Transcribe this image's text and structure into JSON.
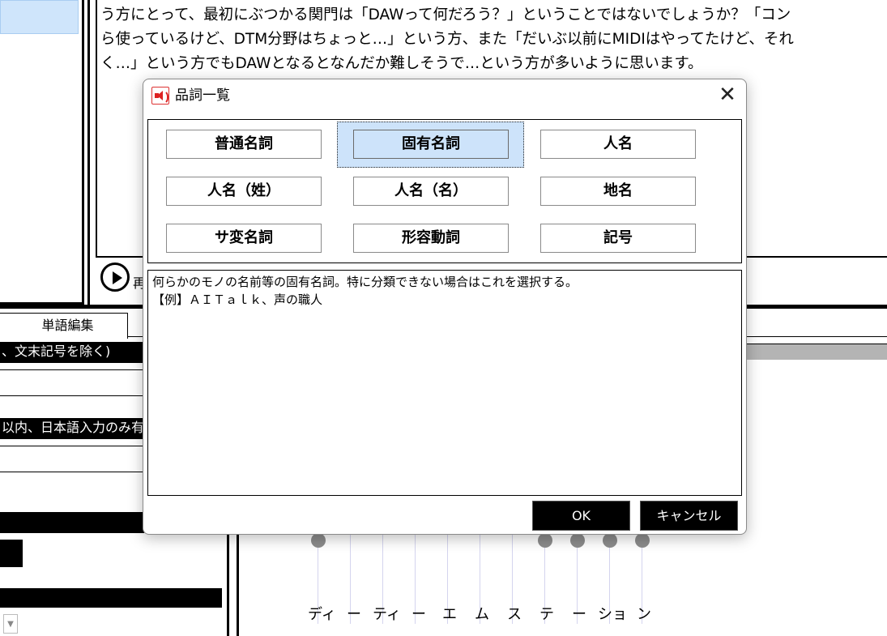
{
  "document": {
    "line1": "う方にとって、最初にぶつかる関門は「DAWって何だろう？」ということではないでしょうか？「コン",
    "line2": "ら使っているけど、DTM分野はちょっと…」という方、また「だいぶ以前にMIDIはやってたけど、それ",
    "line3": "く…」という方でもDAWとなるとなんだか難しそうで…という方が多いように思います。"
  },
  "player": {
    "play_label": "再"
  },
  "word_edit": {
    "tab_label": "単語編集",
    "bar1": "、文末記号を除く)",
    "bar2": "以内、日本語入力のみ有"
  },
  "accent_editor": {
    "kana": [
      "ディ",
      "ー",
      "ティ",
      "ー",
      "エ",
      "ム",
      "ス",
      "テ",
      "ー",
      "ショ",
      "ン"
    ]
  },
  "dialog": {
    "title": "品詞一覧",
    "close_glyph": "✕",
    "parts_of_speech": [
      "普通名詞",
      "固有名詞",
      "人名",
      "人名（姓）",
      "人名（名）",
      "地名",
      "サ変名詞",
      "形容動詞",
      "記号"
    ],
    "selected_index": 1,
    "description_line1": "何らかのモノの名前等の固有名詞。特に分類できない場合はこれを選択する。",
    "description_line2": "【例】ＡＩＴａｌｋ、声の職人",
    "ok_label": "OK",
    "cancel_label": "キャンセル"
  },
  "colors": {
    "selection": "#cde3fa",
    "icon_red": "#d22"
  }
}
